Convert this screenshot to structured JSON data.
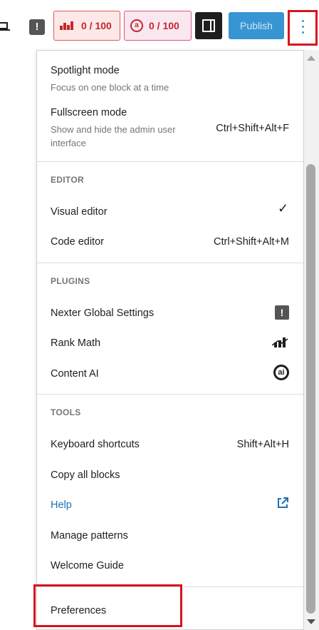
{
  "toolbar": {
    "rank_math_score": "0 / 100",
    "content_ai_score": "0 / 100",
    "publish_label": "Publish",
    "nexter_icon_glyph": "!"
  },
  "menu": {
    "view": [
      {
        "label": "Spotlight mode",
        "description": "Focus on one block at a time"
      },
      {
        "label": "Fullscreen mode",
        "description": "Show and hide the admin user interface",
        "shortcut": "Ctrl+Shift+Alt+F"
      }
    ],
    "editor": {
      "heading": "EDITOR",
      "items": [
        {
          "label": "Visual editor",
          "checked": true,
          "check_glyph": "✓"
        },
        {
          "label": "Code editor",
          "shortcut": "Ctrl+Shift+Alt+M"
        }
      ]
    },
    "plugins": {
      "heading": "PLUGINS",
      "items": [
        {
          "label": "Nexter Global Settings",
          "icon": "nexter-icon"
        },
        {
          "label": "Rank Math",
          "icon": "rank-math-icon"
        },
        {
          "label": "Content AI",
          "icon": "content-ai-icon"
        }
      ]
    },
    "tools": {
      "heading": "TOOLS",
      "items": [
        {
          "label": "Keyboard shortcuts",
          "shortcut": "Shift+Alt+H"
        },
        {
          "label": "Copy all blocks"
        },
        {
          "label": "Help",
          "icon": "external-link-icon",
          "color": "#2271b1"
        },
        {
          "label": "Manage patterns"
        },
        {
          "label": "Welcome Guide"
        }
      ]
    },
    "preferences": {
      "label": "Preferences"
    }
  },
  "colors": {
    "accent": "#3895d3",
    "highlight": "#d6141f",
    "rank_math_red": "#c0282d",
    "help_link": "#2271b1"
  }
}
